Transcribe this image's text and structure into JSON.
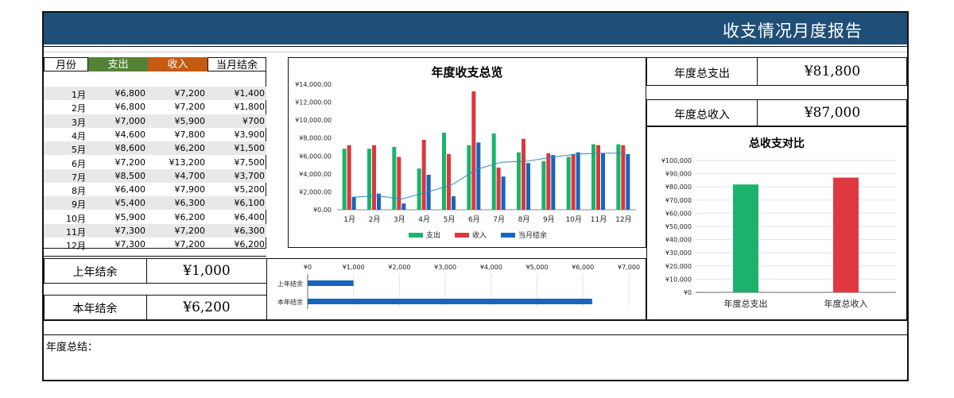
{
  "report": {
    "title": "收支情况月度报告",
    "summary_label": "年度总结："
  },
  "table": {
    "headers": [
      "月份",
      "支出",
      "收入",
      "当月结余"
    ],
    "header_colors": {
      "expense": "#548235",
      "income": "#c55a11"
    },
    "rows": [
      {
        "month": "1月",
        "expense": "¥6,800",
        "income": "¥7,200",
        "balance": "¥1,400"
      },
      {
        "month": "2月",
        "expense": "¥6,800",
        "income": "¥7,200",
        "balance": "¥1,800"
      },
      {
        "month": "3月",
        "expense": "¥7,000",
        "income": "¥5,900",
        "balance": "¥700"
      },
      {
        "month": "4月",
        "expense": "¥4,600",
        "income": "¥7,800",
        "balance": "¥3,900"
      },
      {
        "month": "5月",
        "expense": "¥8,600",
        "income": "¥6,200",
        "balance": "¥1,500"
      },
      {
        "month": "6月",
        "expense": "¥7,200",
        "income": "¥13,200",
        "balance": "¥7,500"
      },
      {
        "month": "7月",
        "expense": "¥8,500",
        "income": "¥4,700",
        "balance": "¥3,700"
      },
      {
        "month": "8月",
        "expense": "¥6,400",
        "income": "¥7,900",
        "balance": "¥5,200"
      },
      {
        "month": "9月",
        "expense": "¥5,400",
        "income": "¥6,300",
        "balance": "¥6,100"
      },
      {
        "month": "10月",
        "expense": "¥5,900",
        "income": "¥6,200",
        "balance": "¥6,400"
      },
      {
        "month": "11月",
        "expense": "¥7,300",
        "income": "¥7,200",
        "balance": "¥6,300"
      },
      {
        "month": "12月",
        "expense": "¥7,300",
        "income": "¥7,200",
        "balance": "¥6,200"
      }
    ]
  },
  "totals": {
    "expense_label": "年度总支出",
    "expense_value": "¥81,800",
    "income_label": "年度总收入",
    "income_value": "¥87,000"
  },
  "balances": {
    "last_year_label": "上年结余",
    "last_year_value": "¥1,000",
    "this_year_label": "本年结余",
    "this_year_value": "¥6,200"
  },
  "chart_data": [
    {
      "type": "bar",
      "title": "年度收支总览",
      "categories": [
        "1月",
        "2月",
        "3月",
        "4月",
        "5月",
        "6月",
        "7月",
        "8月",
        "9月",
        "10月",
        "11月",
        "12月"
      ],
      "series": [
        {
          "name": "支出",
          "kind": "bar",
          "color": "#1bb36b",
          "values": [
            6800,
            6800,
            7000,
            4600,
            8600,
            7200,
            8500,
            6400,
            5400,
            5900,
            7300,
            7300
          ]
        },
        {
          "name": "收入",
          "kind": "bar",
          "color": "#d9383e",
          "values": [
            7200,
            7200,
            5900,
            7800,
            6200,
            13200,
            4700,
            7900,
            6300,
            6200,
            7200,
            7200
          ]
        },
        {
          "name": "当月结余",
          "kind": "bar",
          "color": "#1565c0",
          "values": [
            1400,
            1800,
            700,
            3900,
            1500,
            7500,
            3700,
            5200,
            6100,
            6400,
            6300,
            6200
          ]
        }
      ],
      "line": {
        "color": "#2e86c1",
        "values": [
          1400,
          1550,
          1200,
          1950,
          2750,
          4500,
          5300,
          5400,
          5850,
          6200,
          6300,
          6300
        ]
      },
      "ylim": [
        0,
        14000
      ],
      "yticks": [
        "¥0.00",
        "¥2,000.00",
        "¥4,000.00",
        "¥6,000.00",
        "¥8,000.00",
        "¥10,000.00",
        "¥12,000.00",
        "¥14,000.00"
      ],
      "legend": "bottom"
    },
    {
      "type": "bar",
      "orientation": "horizontal",
      "categories": [
        "上年结余",
        "本年结余"
      ],
      "values": [
        1000,
        6200
      ],
      "xlim": [
        0,
        7000
      ],
      "xticks": [
        "¥0",
        "¥1,000",
        "¥2,000",
        "¥3,000",
        "¥4,000",
        "¥5,000",
        "¥6,000",
        "¥7,000"
      ],
      "color": "#1565c0"
    },
    {
      "type": "bar",
      "title": "总收支对比",
      "categories": [
        "年度总支出",
        "年度总收入"
      ],
      "values": [
        81800,
        87000
      ],
      "colors": [
        "#1bb36b",
        "#e0383e"
      ],
      "ylim": [
        0,
        100000
      ],
      "yticks": [
        "¥0",
        "¥10,000",
        "¥20,000",
        "¥30,000",
        "¥40,000",
        "¥50,000",
        "¥60,000",
        "¥70,000",
        "¥80,000",
        "¥90,000",
        "¥100,000"
      ]
    }
  ]
}
